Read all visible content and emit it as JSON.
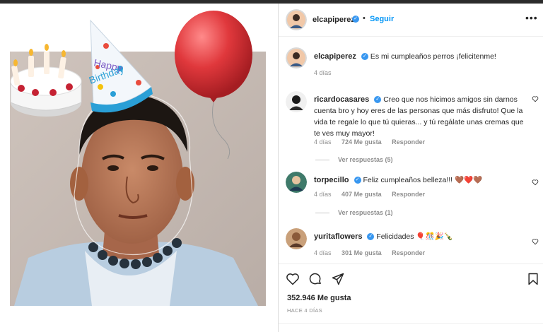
{
  "post": {
    "username": "elcapiperez",
    "verified_mark": "✓",
    "follow_label": "Seguir",
    "separator": "•",
    "more_label": "•••",
    "caption": "Es mi cumpleaños perros ¡felicitenme!",
    "caption_age": "4 días",
    "photo": {
      "hat_text": "Happy Birthday",
      "icons": [
        "birthday-cake-emoji",
        "party-hat",
        "red-balloon"
      ]
    }
  },
  "comments": [
    {
      "username": "ricardocasares",
      "text": "Creo que nos hicimos amigos sin darnos cuenta bro y hoy eres de las personas que más disfruto! Que la vida te regale lo que tú quieras... y tú regálate unas cremas que te ves muy mayor!",
      "age": "4 días",
      "likes": "724 Me gusta",
      "reply": "Responder",
      "replies": "Ver respuestas (5)"
    },
    {
      "username": "torpecillo",
      "text": "Feliz cumpleaños belleza!!! 🤎❤️🤎",
      "age": "4 días",
      "likes": "407 Me gusta",
      "reply": "Responder",
      "replies": "Ver respuestas (1)"
    },
    {
      "username": "yuritaflowers",
      "text": "Felicidades 🎈🎊🎉🍾",
      "age": "4 días",
      "likes": "301 Me gusta",
      "reply": "Responder"
    }
  ],
  "footer": {
    "likes": "352.946 Me gusta",
    "time": "HACE 4 DÍAS"
  },
  "colors": {
    "accent": "#0095f6",
    "verified": "#3897f0",
    "balloon": "#e0383c",
    "muted": "#8e8e8e"
  }
}
